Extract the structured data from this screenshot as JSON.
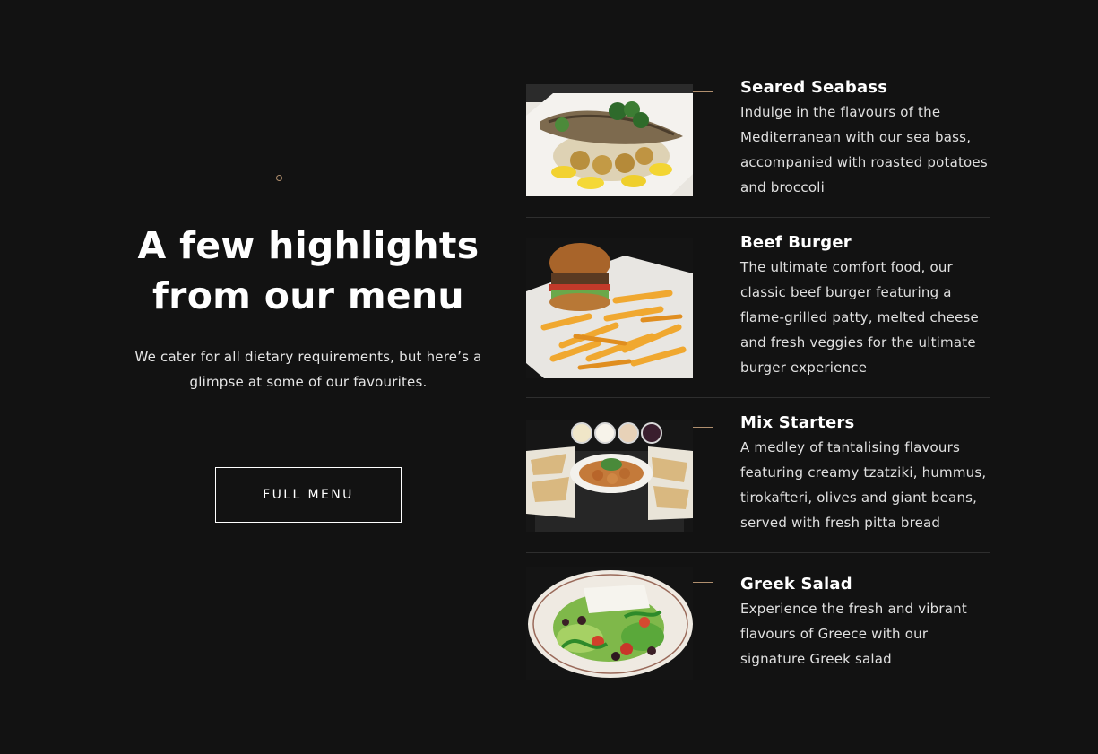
{
  "intro": {
    "heading": "A few highlights from our menu",
    "subtext": "We cater for all dietary requirements, but here’s a glimpse at some of our favourites.",
    "button_label": "FULL MENU"
  },
  "colors": {
    "background": "#121212",
    "accent": "#b08f6e",
    "text": "#ffffff"
  },
  "menu_items": [
    {
      "name": "Seared Seabass",
      "description": "Indulge in the flavours of the Mediterranean with our sea bass, accompanied with roasted potatoes and broccoli",
      "image": "seabass-photo"
    },
    {
      "name": "Beef Burger",
      "description": "The ultimate comfort food, our classic beef burger featuring a flame-grilled patty, melted cheese and fresh veggies for the ultimate burger experience",
      "image": "burger-photo"
    },
    {
      "name": "Mix Starters",
      "description": "A medley of tantalising flavours featuring creamy tzatziki, hummus, tirokafteri, olives and giant beans, served with fresh pitta bread",
      "image": "starters-photo"
    },
    {
      "name": "Greek Salad",
      "description": "Experience the fresh and vibrant flavours of Greece with our signature Greek salad",
      "image": "salad-photo"
    }
  ]
}
